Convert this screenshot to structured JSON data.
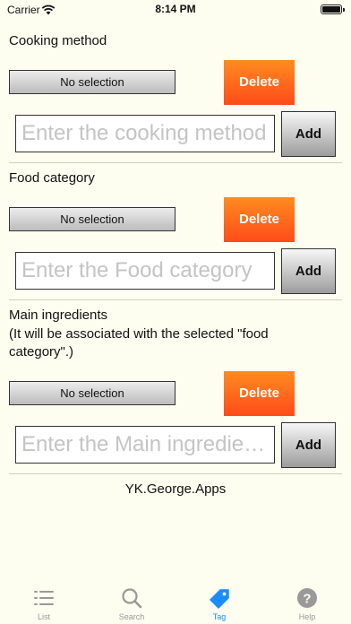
{
  "status_bar": {
    "carrier": "Carrier",
    "time": "8:14 PM"
  },
  "sections": [
    {
      "title": "Cooking method",
      "picker_label": "No selection",
      "delete_label": "Delete",
      "input_placeholder": "Enter the cooking method",
      "add_label": "Add"
    },
    {
      "title": "Food category",
      "picker_label": "No selection",
      "delete_label": "Delete",
      "input_placeholder": "Enter the Food category",
      "add_label": "Add"
    },
    {
      "title": "Main ingredients",
      "subtitle": "(It will be associated with the selected \"food category\".)",
      "picker_label": "No selection",
      "delete_label": "Delete",
      "input_placeholder": "Enter the Main ingredients",
      "add_label": "Add"
    }
  ],
  "footer": {
    "credit": "YK.George.Apps"
  },
  "tabbar": {
    "active_color": "#1a8cff",
    "inactive_color": "#999999",
    "items": [
      {
        "label": "List",
        "icon": "list-icon",
        "active": false
      },
      {
        "label": "Search",
        "icon": "search-icon",
        "active": false
      },
      {
        "label": "Tag",
        "icon": "tag-icon",
        "active": true
      },
      {
        "label": "Help",
        "icon": "help-icon",
        "active": false
      }
    ]
  }
}
